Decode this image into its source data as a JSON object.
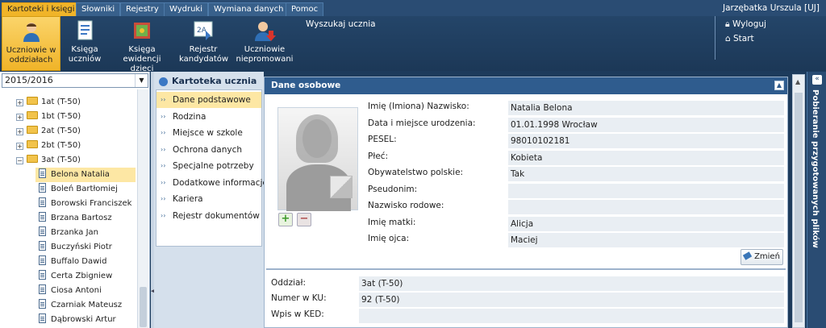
{
  "menu": {
    "tabs": [
      "Kartoteki i księgi",
      "Słowniki",
      "Rejestry",
      "Wydruki",
      "Wymiana danych",
      "Pomoc"
    ],
    "user": "Jarzębatka Urszula [UJ]"
  },
  "toolbar": {
    "buttons": [
      {
        "label": "Uczniowie w oddziałach",
        "icon": "student-icon"
      },
      {
        "label": "Księga uczniów",
        "icon": "ledger-icon"
      },
      {
        "label": "Księga ewidencji dzieci",
        "icon": "map-book-icon"
      },
      {
        "label": "Rejestr kandydatów",
        "icon": "candidate-register-icon"
      },
      {
        "label": "Uczniowie niepromowani",
        "icon": "student-down-icon"
      }
    ],
    "search_label": "Wyszukaj ucznia",
    "logout": "Wyloguj",
    "start": "Start"
  },
  "sidebar": {
    "year": "2015/2016",
    "classes": [
      "1at (T-50)",
      "1bt (T-50)",
      "2at (T-50)",
      "2bt (T-50)",
      "3at (T-50)"
    ],
    "students": [
      "Belona Natalia",
      "Boleń Bartłomiej",
      "Borowski Franciszek",
      "Brzana Bartosz",
      "Brzanka Jan",
      "Buczyński Piotr",
      "Buffalo Dawid",
      "Certa Zbigniew",
      "Ciosa Antoni",
      "Czarniak Mateusz",
      "Dąbrowski Artur"
    ]
  },
  "card": {
    "title": "Kartoteka ucznia",
    "items": [
      "Dane podstawowe",
      "Rodzina",
      "Miejsce w szkole",
      "Ochrona danych",
      "Specjalne potrzeby",
      "Dodatkowe informacje",
      "Kariera",
      "Rejestr dokumentów"
    ]
  },
  "personal": {
    "header": "Dane osobowe",
    "fields": [
      {
        "label": "Imię (Imiona) Nazwisko:",
        "value": "Natalia Belona"
      },
      {
        "label": "Data i miejsce urodzenia:",
        "value": "01.01.1998 Wrocław"
      },
      {
        "label": "PESEL:",
        "value": "98010102181"
      },
      {
        "label": "Płeć:",
        "value": "Kobieta"
      },
      {
        "label": "Obywatelstwo polskie:",
        "value": "Tak"
      },
      {
        "label": "Pseudonim:",
        "value": ""
      },
      {
        "label": "Nazwisko rodowe:",
        "value": ""
      },
      {
        "label": "Imię matki:",
        "value": "Alicja"
      },
      {
        "label": "Imię ojca:",
        "value": "Maciej"
      }
    ],
    "change_button": "Zmień"
  },
  "school": {
    "fields": [
      {
        "label": "Oddział:",
        "value": "3at (T-50)"
      },
      {
        "label": "Numer w KU:",
        "value": "92 (T-50)"
      },
      {
        "label": "Wpis w KED:",
        "value": ""
      }
    ]
  },
  "right_panel": {
    "label": "Pobieranie przygotowanych plików"
  }
}
